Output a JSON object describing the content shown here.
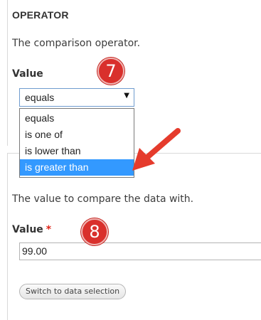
{
  "operator_section": {
    "heading": "OPERATOR",
    "description": "The comparison operator.",
    "field_label": "Value",
    "select": {
      "selected_value": "equals",
      "arrow_glyph": "▼",
      "options": [
        "equals",
        "is one of",
        "is lower than",
        "is greater than"
      ],
      "highlighted_option": "is greater than"
    },
    "step_badge": "7"
  },
  "value_section": {
    "description": "The value to compare the data with.",
    "field_label": "Value",
    "required_marker": "*",
    "input_value": "99.00",
    "switch_button_label": "Switch to data selection",
    "step_badge": "8"
  },
  "annotation": {
    "arrow_icon": "red-arrow-icon",
    "arrow_color": "#e53b2c",
    "badge_color": "#d9302c"
  },
  "colors": {
    "highlight": "#3399ff",
    "select_border": "#6f9ccf",
    "required": "#e0261a"
  }
}
